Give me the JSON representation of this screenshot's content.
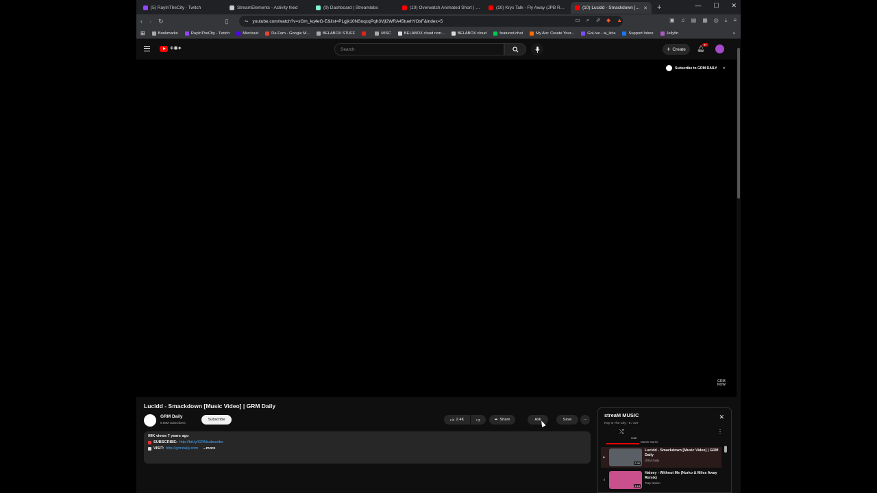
{
  "browser": {
    "tabs": [
      {
        "title": "(5) RayInTheCity - Twitch",
        "color": "#9146ff",
        "active": false
      },
      {
        "title": "StreamElements - Activity feed",
        "color": "#cccccc",
        "active": false
      },
      {
        "title": "(9) Dashboard | Streamlabs",
        "color": "#80f5d2",
        "active": false
      },
      {
        "title": "(10) Overwatch Animated Short | \"Ki",
        "color": "#ff0000",
        "active": false
      },
      {
        "title": "(10) Krys Talk - Fly Away (JPB Remix)",
        "color": "#ff0000",
        "active": false
      },
      {
        "title": "(10) Lucidd - Smackdown [Music",
        "color": "#ff0000",
        "active": true
      }
    ],
    "new_tab": "+",
    "url": "youtube.com/watch?v=xGm_kq4eG-E&list=PLgjk10NSoqcqPqh3VjI2WRA45tuehYOsF&index=5",
    "bookmarks": [
      {
        "label": "Bookmarks",
        "color": "#aaaaaa"
      },
      {
        "label": "RayInTheCity - Twitch",
        "color": "#9146ff"
      },
      {
        "label": "Mixcloud",
        "color": "#5000ff"
      },
      {
        "label": "Da Fam - Google M...",
        "color": "#ea4335"
      },
      {
        "label": "BELABOX STUFF",
        "color": "#aaaaaa"
      },
      {
        "label": "",
        "color": "#e62117"
      },
      {
        "label": "MISC",
        "color": "#aaaaaa"
      },
      {
        "label": "BELABOX cloud rem...",
        "color": "#dddddd"
      },
      {
        "label": "BELABOX cloud",
        "color": "#dddddd"
      },
      {
        "label": "featured.chat",
        "color": "#00c853"
      },
      {
        "label": "My Ato: Create Your...",
        "color": "#ff6d00"
      },
      {
        "label": "GoLive - ai_licia",
        "color": "#7c4dff"
      },
      {
        "label": "Support Inbox",
        "color": "#1877f2"
      },
      {
        "label": "Jellyfin",
        "color": "#aa5cc3"
      }
    ]
  },
  "masthead": {
    "search_placeholder": "Search",
    "create_label": "Create",
    "notification_badge": "9+"
  },
  "player": {
    "subscribe_overlay": "Subscribe to GRM DAILY",
    "watermark_top": "GRM",
    "watermark_bottom": "NOW"
  },
  "video": {
    "title": "Lucidd - Smackdown [Music Video] | GRM Daily",
    "channel_name": "GRM Daily",
    "channel_subs": "6.69M subscribers",
    "subscribe_label": "Subscribe",
    "likes": "2.4K",
    "share_label": "Share",
    "ask_label": "Ask",
    "save_label": "Save",
    "more_label": "···"
  },
  "description": {
    "meta": "99K views  7 years ago",
    "subscribe_prefix": "SUBSCRIBE:",
    "subscribe_link": "http://bit.ly/GRMsubscribe",
    "visit_prefix": "VISIT:",
    "visit_link": "http://grmdaily.com",
    "more_label": "...more"
  },
  "playlist": {
    "title": "streaM MUSIC",
    "owner": "Ray In The City - 5 / 337",
    "partial_channel": "Martin Garrix",
    "partial_duration": "4:43",
    "items": [
      {
        "index": "▶",
        "title": "Lucidd - Smackdown [Music Video] | GRM Daily",
        "channel": "GRM Daily",
        "duration": "2:30",
        "thumb_color": "#5a5f66",
        "active": true
      },
      {
        "index": "6",
        "title": "Halsey - Without Me (Nurko & Miles Away Remix)",
        "channel": "Trap Nation",
        "duration": "4:18",
        "thumb_color": "#c94f8d",
        "active": false
      }
    ]
  }
}
